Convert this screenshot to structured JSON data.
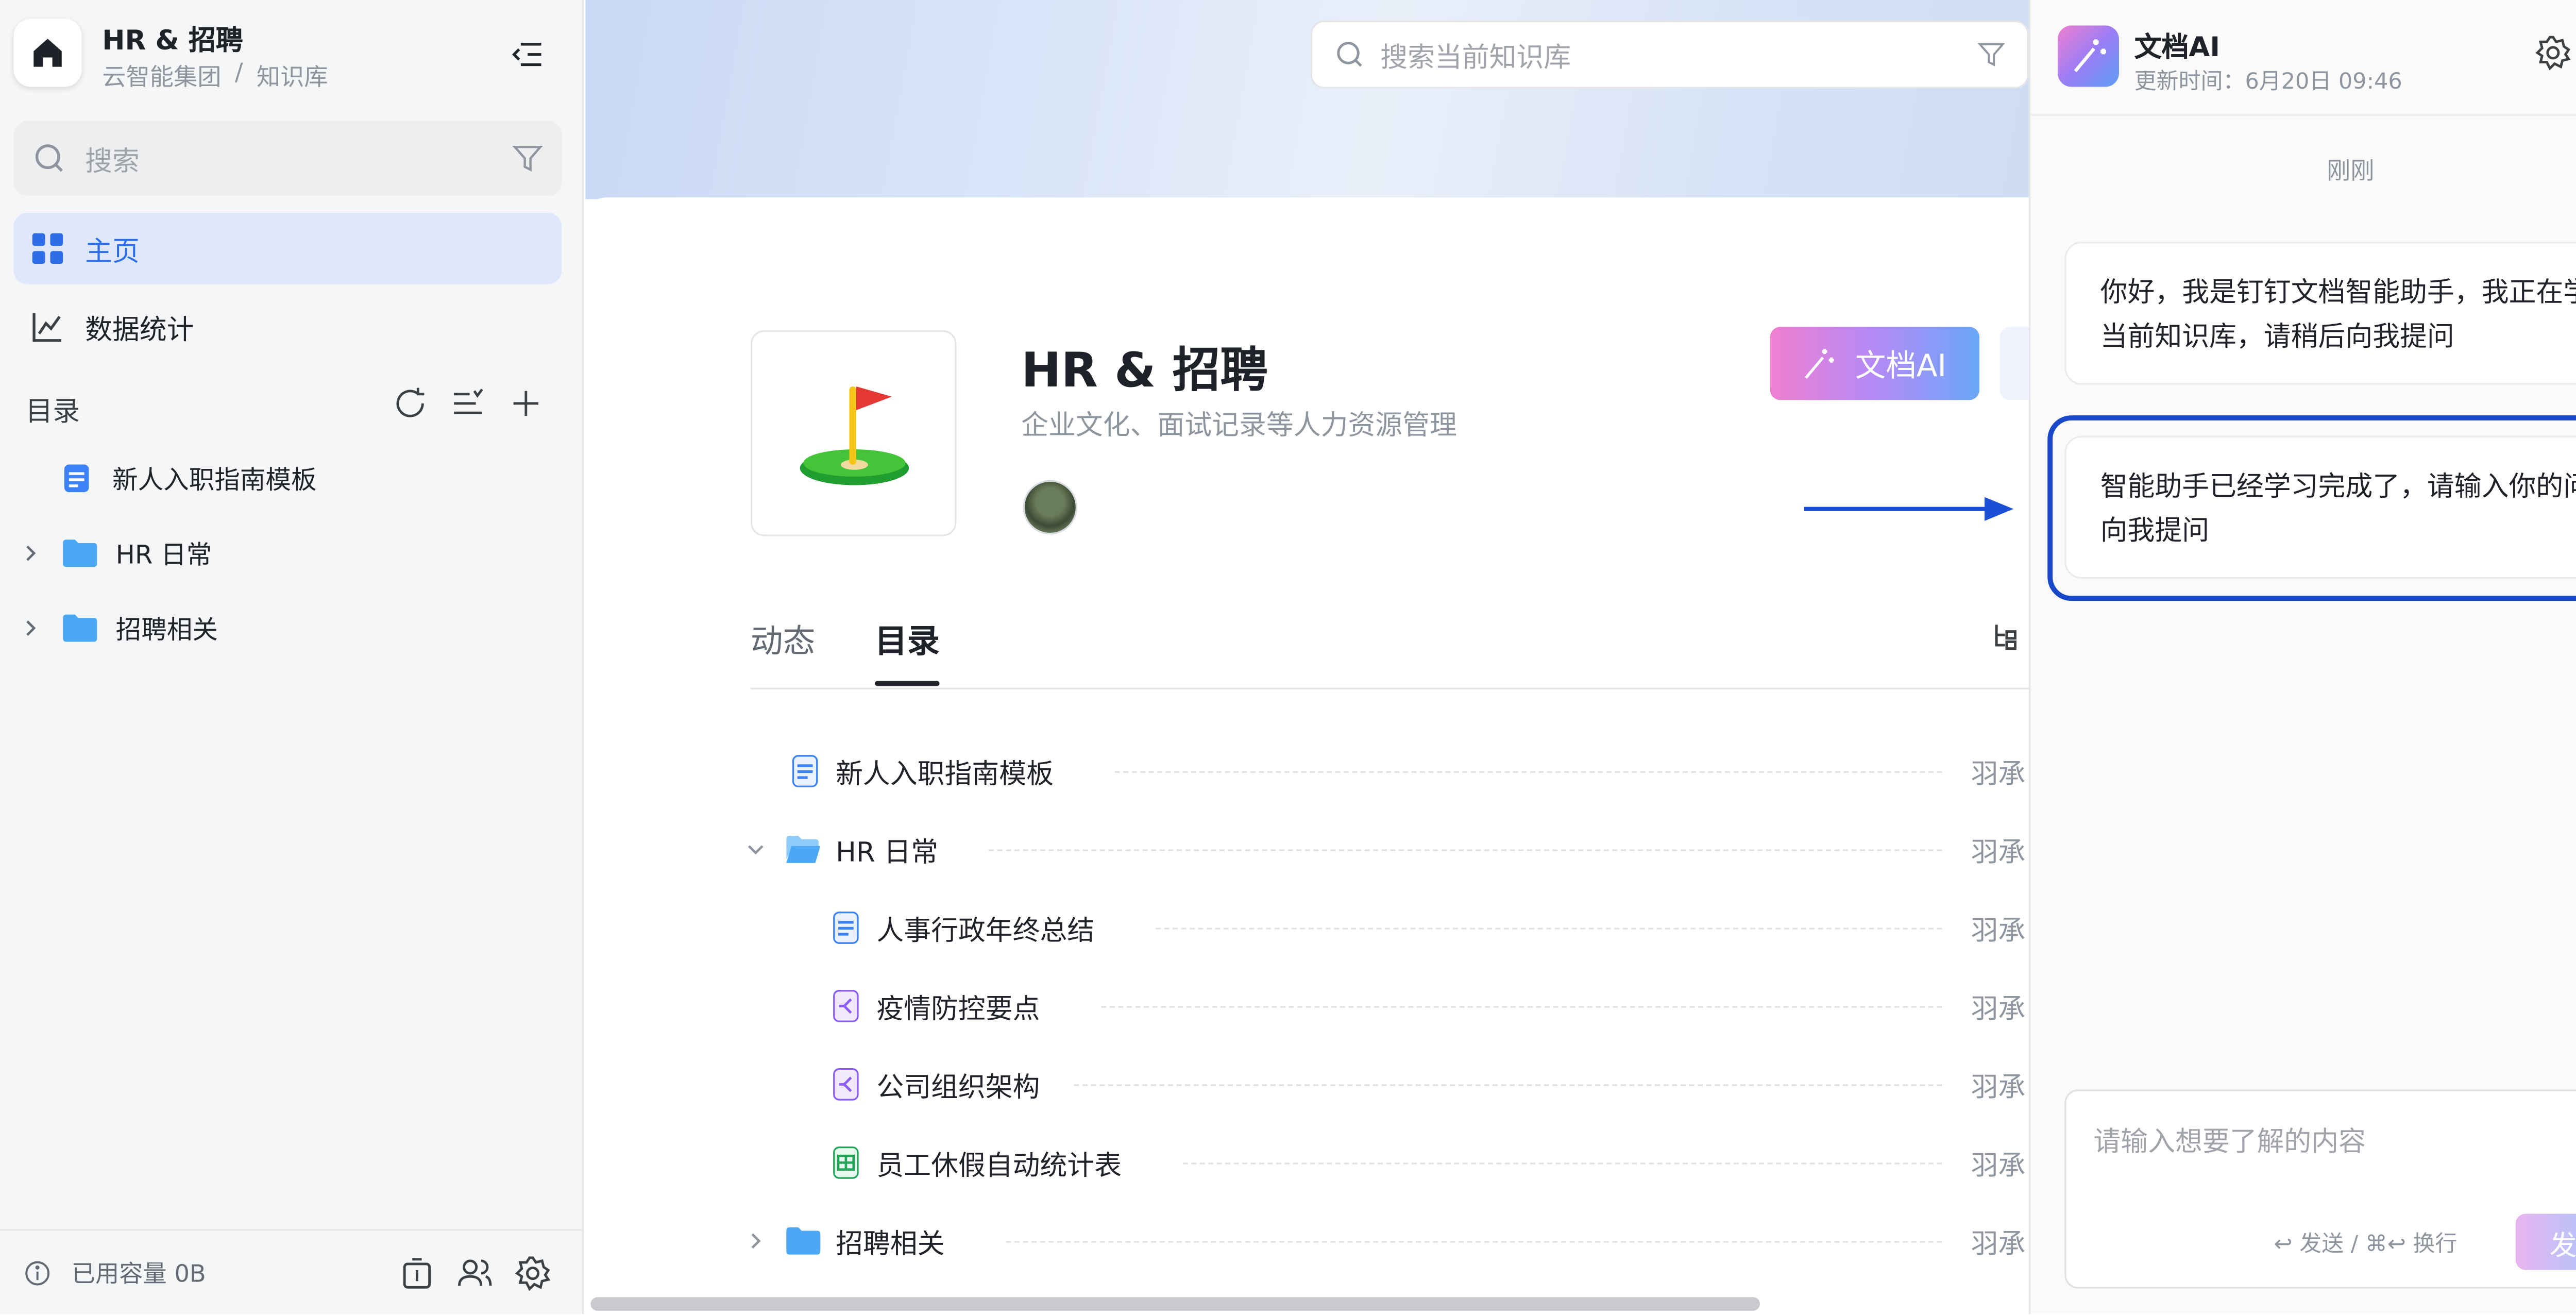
{
  "sidebar": {
    "kb_title": "HR & 招聘",
    "breadcrumb": [
      "云智能集团",
      "/",
      "知识库"
    ],
    "search_placeholder": "搜索",
    "nav": [
      {
        "label": "主页",
        "icon": "grid-icon",
        "active": true
      },
      {
        "label": "数据统计",
        "icon": "line-chart-icon",
        "active": false
      }
    ],
    "directory_label": "目录",
    "tree": [
      {
        "label": "新人入职指南模板",
        "type": "doc"
      },
      {
        "label": "HR 日常",
        "type": "folder"
      },
      {
        "label": "招聘相关",
        "type": "folder"
      }
    ],
    "footer_capacity": "已用容量 0B"
  },
  "main": {
    "search_placeholder": "搜索当前知识库",
    "kb_name": "HR & 招聘",
    "kb_desc": "企业文化、面试记录等人力资源管理",
    "ai_button_label": "文档AI",
    "tabs": [
      {
        "label": "动态",
        "active": false
      },
      {
        "label": "目录",
        "active": true
      }
    ],
    "rows": [
      {
        "name": "新人入职指南模板",
        "owner": "羽承",
        "type": "doc",
        "level": 0
      },
      {
        "name": "HR 日常",
        "owner": "羽承",
        "type": "folder-open",
        "level": 0
      },
      {
        "name": "人事行政年终总结",
        "owner": "羽承",
        "type": "doc",
        "level": 1
      },
      {
        "name": "疫情防控要点",
        "owner": "羽承",
        "type": "mindmap",
        "level": 1
      },
      {
        "name": "公司组织架构",
        "owner": "羽承",
        "type": "mindmap",
        "level": 1
      },
      {
        "name": "员工休假自动统计表",
        "owner": "羽承",
        "type": "sheet",
        "level": 1
      },
      {
        "name": "招聘相关",
        "owner": "羽承",
        "type": "folder",
        "level": 0
      }
    ]
  },
  "ai_panel": {
    "title": "文档AI",
    "updated": "更新时间：6月20日 09:46",
    "time_label": "刚刚",
    "messages": [
      "你好，我是钉钉文档智能助手，我正在学习当前知识库，请稍后向我提问",
      "智能助手已经学习完成了，请输入你的问题向我提问"
    ],
    "input_placeholder": "请输入想要了解的内容",
    "shortcut_hint": "↩ 发送 / ⌘↩ 换行",
    "send_label": "发送"
  },
  "colors": {
    "accent": "#2d6ee8",
    "highlight_border": "#1848c9",
    "arrow": "#1a4fd6",
    "ai_gradient": [
      "#f07fd0",
      "#b48af7",
      "#6aa7f7"
    ]
  }
}
